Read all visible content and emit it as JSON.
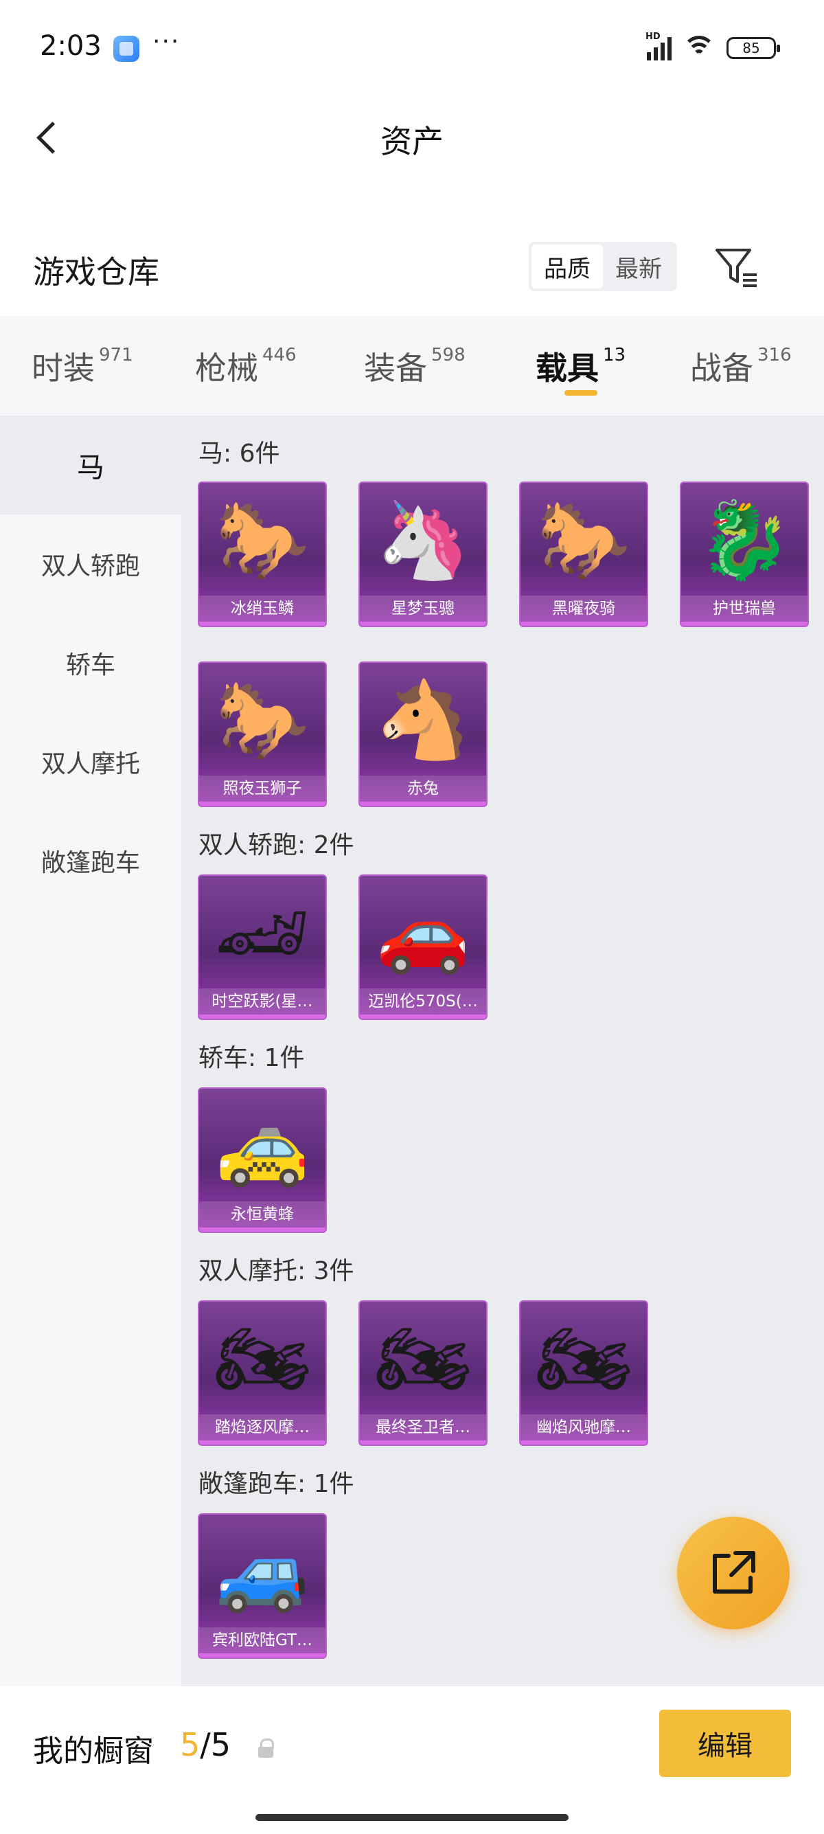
{
  "status_bar": {
    "time": "2:03",
    "dots": "···",
    "signal_tag": "HD",
    "battery": "85"
  },
  "nav": {
    "title": "资产"
  },
  "section": {
    "title": "游戏仓库",
    "sort": [
      "品质",
      "最新"
    ],
    "sort_active": 0
  },
  "tabs": [
    {
      "label": "时装",
      "count": "971"
    },
    {
      "label": "枪械",
      "count": "446"
    },
    {
      "label": "装备",
      "count": "598"
    },
    {
      "label": "载具",
      "count": "13"
    },
    {
      "label": "战备",
      "count": "316"
    }
  ],
  "sidebar": [
    "马",
    "双人轿跑",
    "轿车",
    "双人摩托",
    "敞篷跑车"
  ],
  "groups": [
    {
      "title": "马: 6件",
      "items": [
        {
          "name": "冰绡玉鳞",
          "icon": "horse-icon"
        },
        {
          "name": "星梦玉骢",
          "icon": "horse-icon"
        },
        {
          "name": "黑曜夜骑",
          "icon": "horse-icon"
        },
        {
          "name": "护世瑞兽",
          "icon": "horse-icon"
        },
        {
          "name": "照夜玉狮子",
          "icon": "horse-icon"
        },
        {
          "name": "赤兔",
          "icon": "horse-icon"
        }
      ]
    },
    {
      "title": "双人轿跑: 2件",
      "items": [
        {
          "name": "时空跃影(星…",
          "icon": "car-icon"
        },
        {
          "name": "迈凯伦570S(…",
          "icon": "car-icon"
        }
      ]
    },
    {
      "title": "轿车: 1件",
      "items": [
        {
          "name": "永恒黄蜂",
          "icon": "car-icon"
        }
      ]
    },
    {
      "title": "双人摩托: 3件",
      "items": [
        {
          "name": "踏焰逐风摩…",
          "icon": "motorcycle-icon"
        },
        {
          "name": "最终圣卫者…",
          "icon": "motorcycle-icon"
        },
        {
          "name": "幽焰风驰摩…",
          "icon": "motorcycle-icon"
        }
      ]
    },
    {
      "title": "敞篷跑车: 1件",
      "items": [
        {
          "name": "宾利欧陆GT…",
          "icon": "car-icon"
        }
      ]
    }
  ],
  "bottom": {
    "label": "我的橱窗",
    "current": "5",
    "separator": "/",
    "total": "5",
    "edit": "编辑"
  }
}
